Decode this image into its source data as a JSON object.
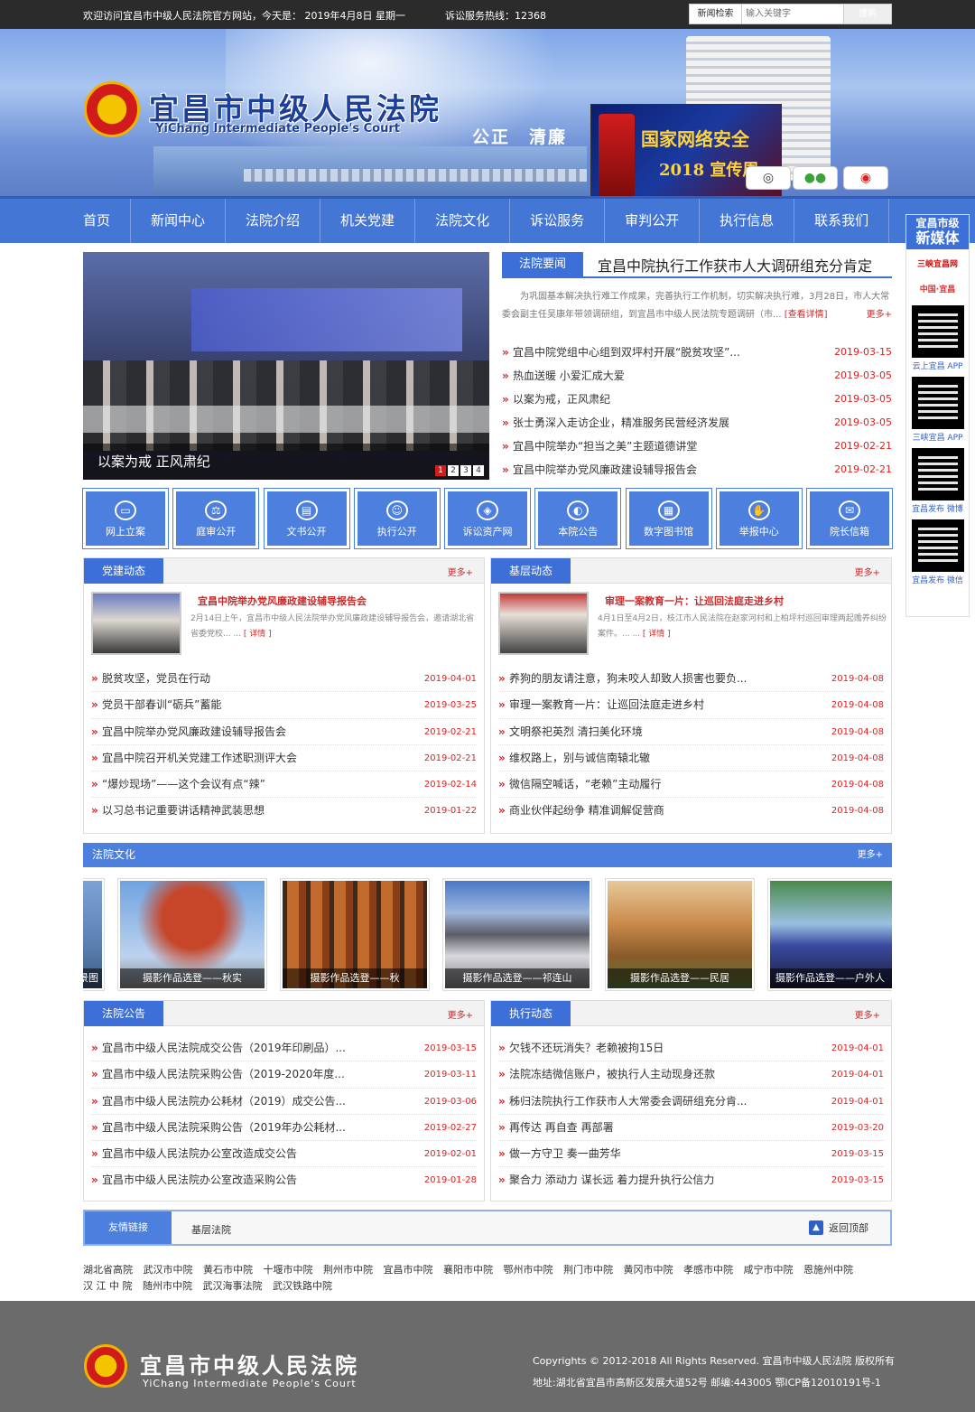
{
  "topbar": {
    "welcome": "欢迎访问宜昌市中级人民法院官方网站，今天是： 2019年4月8日 星期一",
    "hotline": "诉讼服务热线：12368",
    "search_type": "新闻检索",
    "search_placeholder": "输入关键字",
    "search_button": "搜索"
  },
  "banner": {
    "title_cn": "宜昌市中级人民法院",
    "title_en": "YiChang Intermediate People's Court",
    "motto": "公正　清廉",
    "promo_line1": "国家网络安全",
    "promo_line2": "2018 宣传周",
    "social": [
      "微博",
      "微信",
      "微博"
    ]
  },
  "nav": [
    "首页",
    "新闻中心",
    "法院介绍",
    "机关党建",
    "法院文化",
    "诉讼服务",
    "审判公开",
    "执行信息",
    "联系我们"
  ],
  "rail": {
    "title_line1": "宜昌市级",
    "title_line2": "新媒体",
    "logo1": "三峡宜昌网",
    "logo2": "中国·宜昌",
    "qr_labels": [
      "云上宜昌 APP",
      "三峡宜昌 APP",
      "宜昌发布 微博",
      "宜昌发布 微信"
    ]
  },
  "slider": {
    "caption": "以案为戒 正风肃纪",
    "dots": [
      "1",
      "2",
      "3",
      "4"
    ]
  },
  "headline": {
    "tag": "法院要闻",
    "title": "宜昌中院执行工作获市人大调研组充分肯定",
    "summary": "为巩固基本解决执行难工作成果，完善执行工作机制，切实解决执行难，3月28日，市人大常委会副主任吴康年带领调研组，到宜昌市中级人民法院专题调研（市...",
    "detail": "[查看详情]",
    "more": "更多+"
  },
  "news": [
    {
      "title": "宜昌中院党组中心组到双坪村开展“脱贫攻坚”...",
      "date": "2019-03-15"
    },
    {
      "title": "热血送暖 小爱汇成大爱",
      "date": "2019-03-05"
    },
    {
      "title": "以案为戒，正风肃纪",
      "date": "2019-03-05"
    },
    {
      "title": "张士勇深入走访企业，精准服务民营经济发展",
      "date": "2019-03-05"
    },
    {
      "title": "宜昌中院举办“担当之美”主题道德讲堂",
      "date": "2019-02-21"
    },
    {
      "title": "宜昌中院举办党风廉政建设辅导报告会",
      "date": "2019-02-21"
    }
  ],
  "quick": [
    {
      "label": "网上立案",
      "icon": "monitor-icon",
      "glyph": "▭"
    },
    {
      "label": "庭审公开",
      "icon": "gavel-icon",
      "glyph": "⚖"
    },
    {
      "label": "文书公开",
      "icon": "document-icon",
      "glyph": "▤"
    },
    {
      "label": "执行公开",
      "icon": "person-icon",
      "glyph": "☺"
    },
    {
      "label": "诉讼资产网",
      "icon": "asset-icon",
      "glyph": "◈"
    },
    {
      "label": "本院公告",
      "icon": "megaphone-icon",
      "glyph": "◐"
    },
    {
      "label": "数字图书馆",
      "icon": "library-icon",
      "glyph": "▦"
    },
    {
      "label": "举报中心",
      "icon": "hand-icon",
      "glyph": "✋"
    },
    {
      "label": "院长信箱",
      "icon": "mail-icon",
      "glyph": "✉"
    }
  ],
  "party": {
    "title": "党建动态",
    "more": "更多+",
    "feature_title": "宜昌中院举办党风廉政建设辅导报告会",
    "feature_summary": "2月14日上午，宜昌市中级人民法院举办党风廉政建设辅导报告会，邀请湖北省省委党校... ...",
    "feature_detail": "[ 详情 ]",
    "items": [
      {
        "title": "脱贫攻坚，党员在行动",
        "date": "2019-04-01"
      },
      {
        "title": "党员干部春训“砺兵”蓄能",
        "date": "2019-03-25"
      },
      {
        "title": "宜昌中院举办党风廉政建设辅导报告会",
        "date": "2019-02-21"
      },
      {
        "title": "宜昌中院召开机关党建工作述职测评大会",
        "date": "2019-02-21"
      },
      {
        "title": "“爆炒现场”——这个会议有点“辣”",
        "date": "2019-02-14"
      },
      {
        "title": "以习总书记重要讲话精神武装思想",
        "date": "2019-01-22"
      }
    ]
  },
  "grassroots": {
    "title": "基层动态",
    "more": "更多+",
    "feature_title": "审理一案教育一片：让巡回法庭走进乡村",
    "feature_summary": "4月1日至4月2日，枝江市人民法院在赵家河村和上柏坪村巡回审理两起赡养纠纷案件。... ...",
    "feature_detail": "[ 详情 ]",
    "items": [
      {
        "title": "养狗的朋友请注意，狗未咬人却致人损害也要负...",
        "date": "2019-04-08"
      },
      {
        "title": "审理一案教育一片：让巡回法庭走进乡村",
        "date": "2019-04-08"
      },
      {
        "title": "文明祭祀英烈 清扫美化环境",
        "date": "2019-04-08"
      },
      {
        "title": "维权路上，别与诚信南辕北辙",
        "date": "2019-04-08"
      },
      {
        "title": "微信隔空喊话，“老赖”主动履行",
        "date": "2019-04-08"
      },
      {
        "title": "商业伙伴起纷争 精准调解促营商",
        "date": "2019-04-08"
      }
    ]
  },
  "culture": {
    "title": "法院文化",
    "more": "更多+",
    "photos": [
      {
        "caption": "景图"
      },
      {
        "caption": "摄影作品选登——秋实"
      },
      {
        "caption": "摄影作品选登——秋"
      },
      {
        "caption": "摄影作品选登——祁连山"
      },
      {
        "caption": "摄影作品选登——民居"
      },
      {
        "caption": "摄影作品选登——户外人"
      }
    ]
  },
  "notices": {
    "title": "法院公告",
    "more": "更多+",
    "items": [
      {
        "title": "宜昌市中级人民法院成交公告（2019年印刷品）...",
        "date": "2019-03-15"
      },
      {
        "title": "宜昌市中级人民法院采购公告（2019-2020年度...",
        "date": "2019-03-11"
      },
      {
        "title": "宜昌市中级人民法院办公耗材（2019）成交公告...",
        "date": "2019-03-06"
      },
      {
        "title": "宜昌市中级人民法院采购公告（2019年办公耗材...",
        "date": "2019-02-27"
      },
      {
        "title": "宜昌市中级人民法院办公室改造成交公告",
        "date": "2019-02-01"
      },
      {
        "title": "宜昌市中级人民法院办公室改造采购公告",
        "date": "2019-01-28"
      }
    ]
  },
  "execution": {
    "title": "执行动态",
    "more": "更多+",
    "items": [
      {
        "title": "欠钱不还玩消失？老赖被拘15日",
        "date": "2019-04-01"
      },
      {
        "title": "法院冻结微信账户，被执行人主动现身还款",
        "date": "2019-04-01"
      },
      {
        "title": "秭归法院执行工作获市人大常委会调研组充分肯...",
        "date": "2019-04-01"
      },
      {
        "title": "再传达 再自查 再部署",
        "date": "2019-03-20"
      },
      {
        "title": "做一方守卫 奏一曲芳华",
        "date": "2019-03-15"
      },
      {
        "title": "聚合力 添动力 谋长远 着力提升执行公信力",
        "date": "2019-03-15"
      }
    ]
  },
  "links": {
    "title": "友情链接",
    "select": "基层法院",
    "back_to_top": "返回顶部"
  },
  "courts": [
    "湖北省高院",
    "武汉市中院",
    "黄石市中院",
    "十堰市中院",
    "荆州市中院",
    "宜昌市中院",
    "襄阳市中院",
    "鄂州市中院",
    "荆门市中院",
    "黄冈市中院",
    "孝感市中院",
    "咸宁市中院",
    "恩施州中院",
    "汉 江 中 院",
    "随州市中院",
    "武汉海事法院",
    "武汉铁路中院"
  ],
  "footer": {
    "title_cn": "宜昌市中级人民法院",
    "title_en": "YiChang Intermediate People's Court",
    "copyright": "Copyrights © 2012-2018 All Rights Reserved. 宜昌市中级人民法院 版权所有",
    "address": "地址:湖北省宜昌市高新区发展大道52号 邮编:443005 鄂ICP备12010191号-1"
  },
  "colors": {
    "primary": "#4476d6",
    "accent_red": "#cc2b2b",
    "footer": "#6b6b6b"
  }
}
